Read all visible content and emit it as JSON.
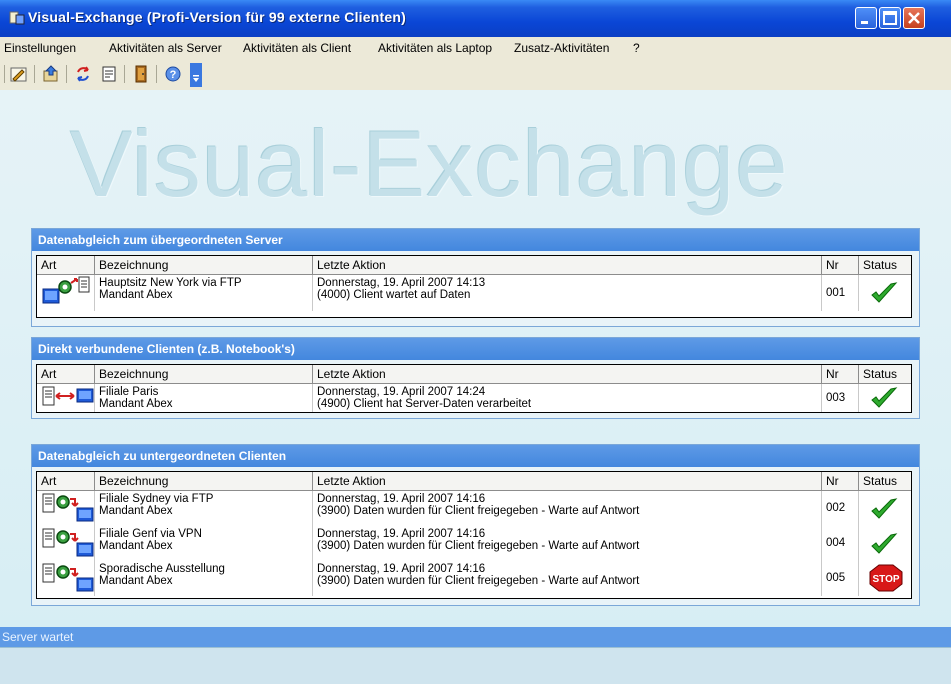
{
  "window": {
    "title": "Visual-Exchange (Profi-Version für 99 externe Clienten)"
  },
  "menu": [
    "Einstellungen",
    "Aktivitäten als Server",
    "Aktivitäten als Client",
    "Aktivitäten als Laptop",
    "Zusatz-Aktivitäten",
    "?"
  ],
  "toolbar": {
    "icons": [
      "edit-icon",
      "export-icon",
      "sync-icon",
      "document-icon",
      "exit-door-icon",
      "help-icon",
      "dropdown-arrow-icon"
    ]
  },
  "logo": "Visual-Exchange",
  "columns": {
    "art": "Art",
    "bezeichnung": "Bezeichnung",
    "aktion": "Letzte Aktion",
    "nr": "Nr",
    "status": "Status"
  },
  "panels": [
    {
      "title": "Datenabgleich zum übergeordneten Server",
      "rows": [
        {
          "name": "Hauptsitz New York via FTP",
          "mandant": "Mandant Abex",
          "datum": "Donnerstag, 19. April 2007 14:13",
          "aktion": "(4000) Client wartet auf Daten",
          "nr": "001",
          "status": "ok"
        }
      ]
    },
    {
      "title": "Direkt verbundene Clienten (z.B. Notebook's)",
      "rows": [
        {
          "name": "Filiale Paris",
          "mandant": "Mandant Abex",
          "datum": "Donnerstag, 19. April 2007 14:24",
          "aktion": "(4900) Client hat Server-Daten verarbeitet",
          "nr": "003",
          "status": "ok"
        }
      ]
    },
    {
      "title": "Datenabgleich zu untergeordneten Clienten",
      "rows": [
        {
          "name": "Filiale Sydney via FTP",
          "mandant": "Mandant Abex",
          "datum": "Donnerstag, 19. April 2007 14:16",
          "aktion": "(3900) Daten wurden für Client freigegeben - Warte auf Antwort",
          "nr": "002",
          "status": "ok"
        },
        {
          "name": "Filiale Genf via VPN",
          "mandant": "Mandant Abex",
          "datum": "Donnerstag, 19. April 2007 14:16",
          "aktion": "(3900) Daten wurden für Client freigegeben - Warte auf Antwort",
          "nr": "004",
          "status": "ok"
        },
        {
          "name": "Sporadische Ausstellung",
          "mandant": "Mandant Abex",
          "datum": "Donnerstag, 19. April 2007 14:16",
          "aktion": "(3900) Daten wurden für Client freigegeben - Warte auf Antwort",
          "nr": "005",
          "status": "stop",
          "stop_label": "STOP"
        }
      ]
    }
  ],
  "statusbar": {
    "text": "Server wartet"
  }
}
